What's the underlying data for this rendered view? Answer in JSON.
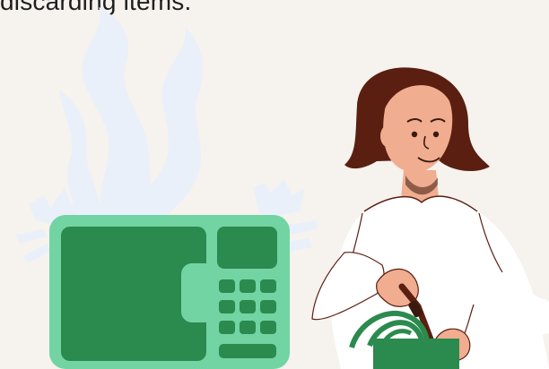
{
  "caption": {
    "text": "discarding items."
  },
  "colors": {
    "background": "#f6f2ee",
    "microwave_body": "#72d4a3",
    "microwave_panel": "#2b8a4e",
    "smoke": "#e9f0fa",
    "hair": "#5a1f10",
    "skin": "#f0ad90",
    "shirt": "#ffffff",
    "bag": "#2b8a4e"
  },
  "icons": [
    "smoke-icon",
    "spark-icon",
    "microwave-icon",
    "person-illustration",
    "shopping-bag-icon",
    "screwdriver-icon"
  ]
}
